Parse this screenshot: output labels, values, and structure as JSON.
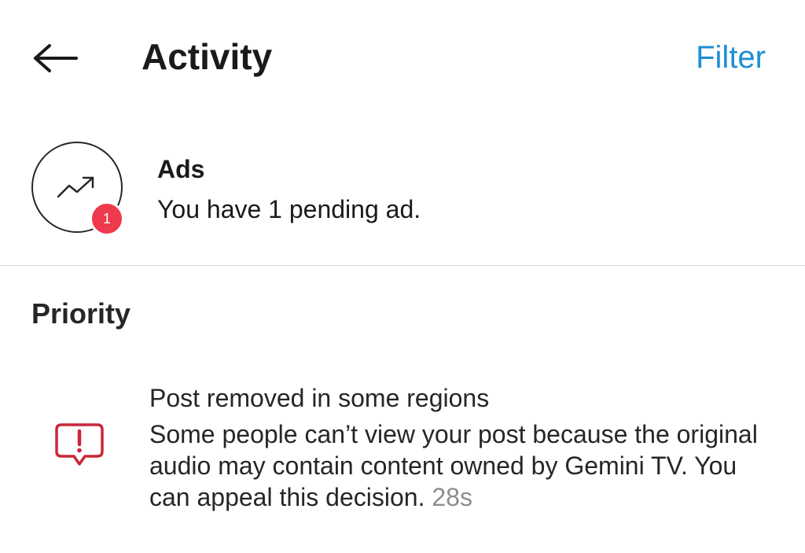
{
  "header": {
    "title": "Activity",
    "filter_label": "Filter",
    "back_icon": "back-arrow-icon"
  },
  "ads": {
    "title": "Ads",
    "subtitle": "You have 1 pending ad.",
    "badge_count": "1",
    "icon": "trending-up-icon",
    "badge_color": "#ed3a4c"
  },
  "priority": {
    "heading": "Priority",
    "items": [
      {
        "icon": "alert-message-icon",
        "title": "Post removed in some regions",
        "body": "Some people can’t view your post because the original audio may contain content owned by Gemini TV. You can appeal this decision.",
        "time": "28s"
      }
    ]
  },
  "colors": {
    "accent": "#1f8ed6",
    "alert": "#c8273a",
    "text_primary": "#262626",
    "text_secondary": "#8e8e8e",
    "divider": "#dbdbdb"
  }
}
